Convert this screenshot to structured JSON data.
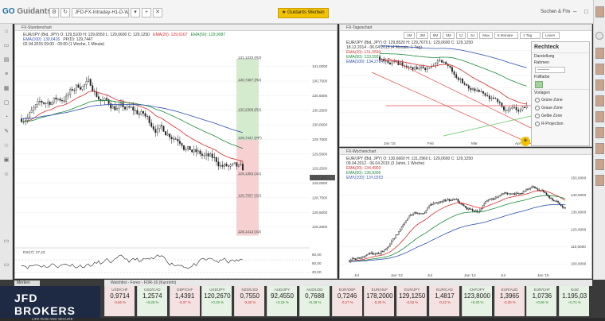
{
  "topbar": {
    "logo_main": "GO",
    "logo_brand": "Guidants",
    "instrument_field": "JFD-FX-Intraday-H1-D-W",
    "star_button": "★ Guidants Werben",
    "search_label": "Suchen & Finden"
  },
  "colors": {
    "ema20": "#d62c2c",
    "ema50": "#1c8a3a",
    "ema100": "#2b4fb0",
    "candle": "#222222",
    "projection_bar": "#f6c9c9",
    "projection_green": "#cfe9c8",
    "channel": "#e24b4b",
    "support": "#7fd17a",
    "accent": "#f2c200"
  },
  "chart_h1": {
    "title": "FX-Stundenchart",
    "info": [
      {
        "label": "EUR/JPY (Bid, JPY)",
        "o": "O: 129,5100",
        "h": "H: 129,6550",
        "l": "L: 129,0600",
        "c": "C: 129,1250"
      },
      {
        "ema20": "EMA(20): 129,6167",
        "ema50": "EMA(50): 129,9087"
      },
      {
        "ema100": "EMA(100): 130,0416",
        "pp": "PP(D): 129,7447"
      },
      {
        "range": "02.04.2015 09:00 - 09:00 (1 Woche, 1 Minute)"
      }
    ],
    "y_ticks": [
      "131,0000",
      "130,7500",
      "130,5000",
      "130,2500",
      "130,0000",
      "129,7500",
      "129,5000",
      "129,2500",
      "129,0000",
      "128,7500",
      "128,5000",
      "128,2500"
    ],
    "levels": [
      {
        "label": "131,1233 (R3)",
        "price": 131.1233
      },
      {
        "label": "130,7387 (R2)",
        "price": 130.7387
      },
      {
        "label": "130,2309 (R1)",
        "price": 130.2309
      },
      {
        "label": "129,7447 (PP)",
        "price": 129.7447
      },
      {
        "label": "129,1353 (S1)",
        "price": 129.1353
      },
      {
        "label": "128,7557 (S2)",
        "price": 128.7557
      },
      {
        "label": "128,1413 (S3)",
        "price": 128.1413
      }
    ],
    "last_price": "129,1250",
    "rsi_label": "RSI(7): 27,43",
    "rsi_ticks": [
      "80,00",
      "50,00",
      "20,00"
    ]
  },
  "chart_daily": {
    "title": "FX-Tageschart",
    "toolbar": [
      "1M",
      "3M",
      "6M",
      "5M",
      "1J",
      "5J",
      "Max",
      "6 Monate",
      "1 Tag",
      "Linien"
    ],
    "info": [
      {
        "label": "EUR/JPY (Bid, JPY)",
        "o": "O: 129,8520",
        "h": "H: 129,7670",
        "l": "L: 129,0600",
        "c": "C: 129,1250"
      },
      {
        "range": "18.12.2014 - 06.04.2015 (4 Monate, 1 Tag)"
      },
      {
        "ema20": "EMA(20): 131,0590"
      },
      {
        "ema50": "EMA(50): 133,5928"
      },
      {
        "ema100": "EMA(100): 134,2784"
      }
    ],
    "y_ticks": [
      "138,0000",
      "136,0000",
      "134,0000",
      "132,0000",
      "130,0000",
      "128,0000",
      "126,0000",
      "124,0000"
    ],
    "x_ticks": [
      "Jan '15",
      "Feb",
      "Mär",
      "Apr"
    ],
    "last_price": "129,1250"
  },
  "chart_weekly": {
    "title": "FX-Wochenchart",
    "info": [
      {
        "label": "EUR/JPY (Bid, JPY)",
        "o": "O: 130,6660",
        "h": "H: 131,2960",
        "l": "L: 129,0600",
        "c": "C: 129,1250"
      },
      {
        "range": "09.04.2012 - 06.04.2015 (3 Jahre, 1 Woche)"
      },
      {
        "ema20": "EMA(20): 134,4903"
      },
      {
        "ema50": "EMA(50): 136,9306"
      },
      {
        "ema100": "EMA(100): 134,0363"
      }
    ],
    "y_ticks": [
      "150,0000",
      "140,0000",
      "130,0000",
      "120,0000",
      "110,0000",
      "100,0000"
    ],
    "x_ticks": [
      "Jul",
      "Jan '13",
      "Jul",
      "Jan '14",
      "Jul",
      "Jan '15"
    ],
    "last_price": "129,1250"
  },
  "toolbox": {
    "title": "Rechteck",
    "section1": "Darstellung",
    "rahmen": "Rahmen",
    "rahmen_value": "———",
    "fill": "Füllfarbe",
    "zones_title": "Vorlagen",
    "zones": [
      "Grüne Zone",
      "Graue Zone",
      "Gelbe Zone",
      "R-Projection"
    ]
  },
  "bottom": {
    "tab": "Merken",
    "broker": "JFD BROKERS",
    "broker_sub": "LIFE RAW AND SECURE",
    "widget_title": "Watchlist - Forex - FDR-16 (Kurzinfo)",
    "tickers": [
      {
        "name": "USD/CHF",
        "value": "0,9714",
        "change": "-0,56 %",
        "dir": "dn"
      },
      {
        "name": "USD/CAD",
        "value": "1,2574",
        "change": "+0,28 %",
        "dir": "up"
      },
      {
        "name": "GBP/CHF",
        "value": "1,4391",
        "change": "-0,37 %",
        "dir": "dn"
      },
      {
        "name": "USD/JPY",
        "value": "120,2670",
        "change": "+0,19 %",
        "dir": "up"
      },
      {
        "name": "NZD/USD",
        "value": "0,7550",
        "change": "-0,36 %",
        "dir": "dn"
      },
      {
        "name": "AUD/JPY",
        "value": "92,4550",
        "change": "+0,19 %",
        "dir": "up"
      },
      {
        "name": "AUD/USD",
        "value": "0,7688",
        "change": "+0,28 %",
        "dir": "up"
      },
      {
        "name": "EUR/GBP",
        "value": "0,7246",
        "change": "-0,27 %",
        "dir": "dn"
      },
      {
        "name": "EUR/HUF",
        "value": "178,2000",
        "change": "-0,25 %",
        "dir": "dn"
      },
      {
        "name": "EUR/JPY",
        "value": "129,1250",
        "change": "-0,53 %",
        "dir": "dn"
      },
      {
        "name": "EUR/CAD",
        "value": "1,4817",
        "change": "-0,22 %",
        "dir": "dn"
      },
      {
        "name": "CHF/JPY",
        "value": "123,8000",
        "change": "+0,40 %",
        "dir": "up"
      },
      {
        "name": "EUR/AUD",
        "value": "1,3965",
        "change": "-0,30 %",
        "dir": "dn"
      },
      {
        "name": "EUR/CHF",
        "value": "1,0736",
        "change": "+0,06 %",
        "dir": "up"
      },
      {
        "name": "Gold",
        "value": "1.195,03",
        "change": "+0,74 %",
        "dir": "up"
      }
    ]
  }
}
